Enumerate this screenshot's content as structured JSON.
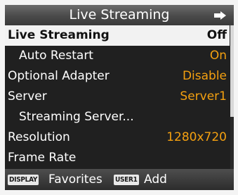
{
  "header": {
    "title": "Live Streaming",
    "back_icon": "return-arrow-icon"
  },
  "menu": {
    "items": [
      {
        "label": "Live Streaming",
        "value": "Off"
      },
      {
        "label": "Auto Restart",
        "value": "On"
      },
      {
        "label": "Optional Adapter",
        "value": "Disable"
      },
      {
        "label": "Server",
        "value": "Server1"
      },
      {
        "label": "Streaming Server...",
        "value": ""
      },
      {
        "label": "Resolution",
        "value": "1280x720"
      },
      {
        "label": "Frame Rate",
        "value": ""
      }
    ]
  },
  "footer": {
    "display_key": "DISPLAY",
    "favorites_label": "Favorites",
    "user1_key": "USER1",
    "add_label": "Add"
  },
  "colors": {
    "value_accent": "#f4a010",
    "selected_row_bg": "#f2f2f2",
    "body_bg": "#202020"
  }
}
